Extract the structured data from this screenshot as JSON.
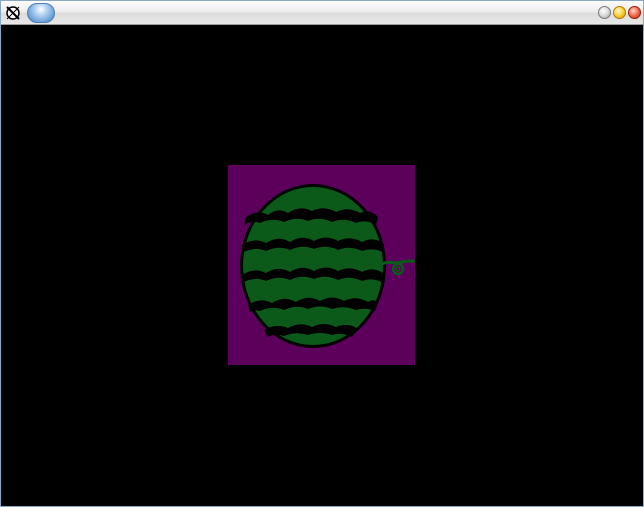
{
  "window": {
    "title": "",
    "buttons": [
      "restore-button",
      "minimize-button",
      "close-button"
    ]
  },
  "icons": {
    "app": "crossed-circle-icon",
    "menu": "menu-pill-icon"
  },
  "canvas": {
    "background": "#000000",
    "sprite_background": "#5c005c",
    "sprite_subject": "watermelon"
  },
  "colors": {
    "melon_green": "#0b5a1a",
    "stripe": "#000000",
    "border": "#8aa9c6"
  }
}
